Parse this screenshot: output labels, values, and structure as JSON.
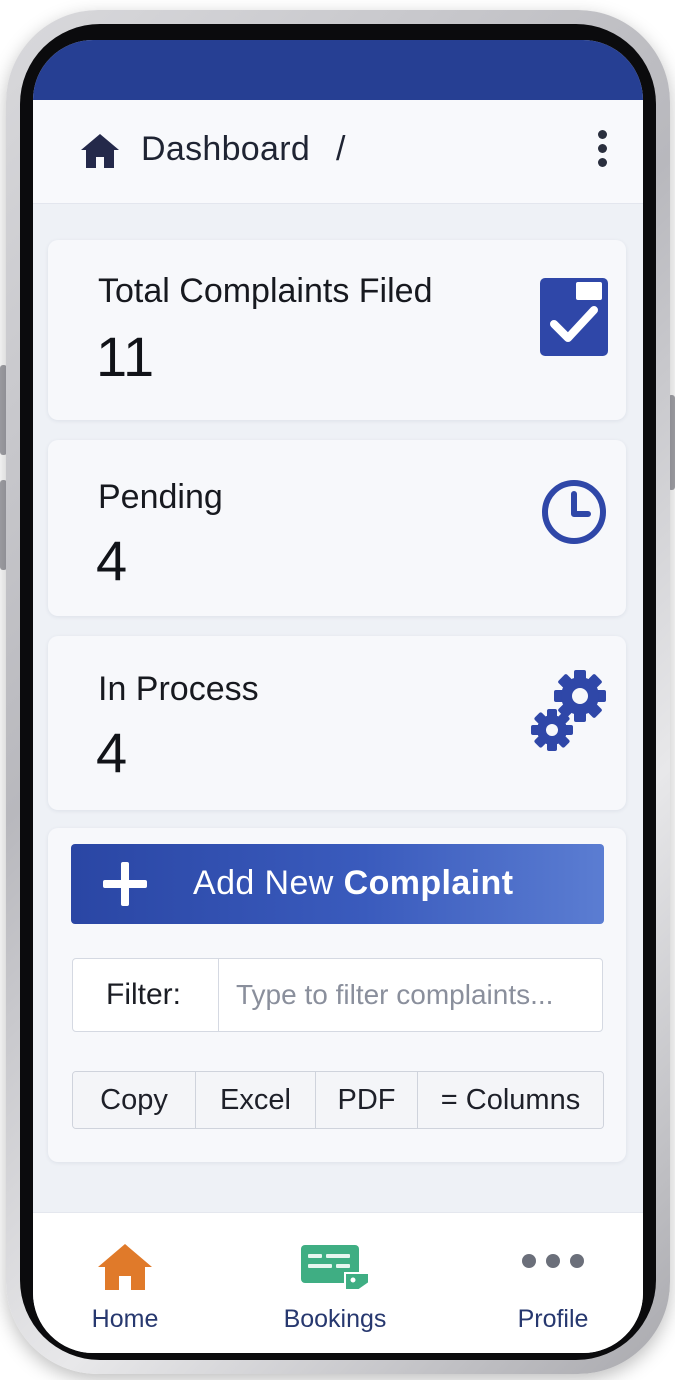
{
  "header": {
    "breadcrumb": "Dashboard",
    "separator": "/"
  },
  "stats": [
    {
      "label": "Total Complaints Filed",
      "value": "11",
      "icon": "checkbox-icon"
    },
    {
      "label": "Pending",
      "value": "4",
      "icon": "clock-icon"
    },
    {
      "label": "In Process",
      "value": "4",
      "icon": "gears-icon"
    }
  ],
  "actions": {
    "add_prefix": "Add New ",
    "add_bold": "Complaint",
    "filter_label": "Filter:",
    "filter_placeholder": "Type to filter complaints...",
    "filter_value": "",
    "export_buttons": [
      "Copy",
      "Excel",
      "PDF",
      "= Columns"
    ]
  },
  "bottom_nav": [
    {
      "label": "Home",
      "icon": "home-icon",
      "active": true
    },
    {
      "label": "Bookings",
      "icon": "bookings-icon",
      "active": false
    },
    {
      "label": "Profile",
      "icon": "more-icon",
      "active": false
    }
  ],
  "colors": {
    "primary": "#263f93",
    "accent_blue": "#2f47a8",
    "home_active": "#e07a2a",
    "bookings_green": "#3fae83",
    "text_dark": "#17191f",
    "nav_label_blue": "#27386f"
  }
}
